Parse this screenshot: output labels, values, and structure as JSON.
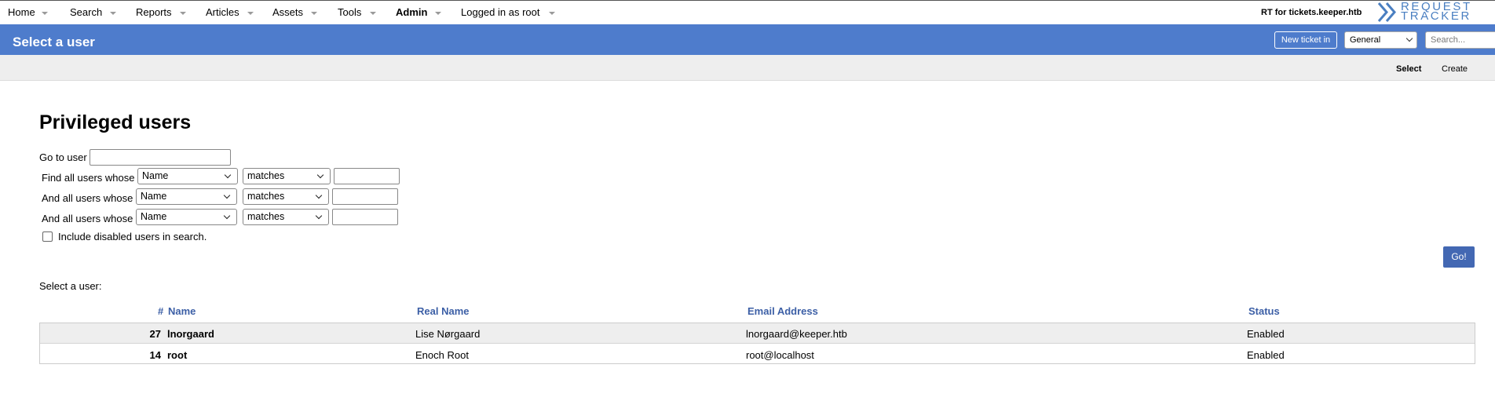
{
  "topnav": {
    "items": [
      {
        "label": "Home"
      },
      {
        "label": "Search"
      },
      {
        "label": "Reports"
      },
      {
        "label": "Articles"
      },
      {
        "label": "Assets"
      },
      {
        "label": "Tools"
      },
      {
        "label": "Admin"
      },
      {
        "label": "Logged in as root"
      }
    ],
    "site_label": "RT for tickets.keeper.htb",
    "logo_line1": "REQUEST",
    "logo_line2": "TRACKER"
  },
  "header": {
    "title": "Select a user",
    "new_ticket_label": "New ticket in",
    "queue_value": "General",
    "search_placeholder": "Search..."
  },
  "subnav": {
    "tabs": [
      {
        "label": "Select",
        "active": true
      },
      {
        "label": "Create",
        "active": false
      }
    ]
  },
  "main": {
    "heading": "Privileged users",
    "goto_label": "Go to user",
    "goto_value": "",
    "criteria": [
      {
        "prefix": "Find all users whose",
        "field": "Name",
        "op": "matches",
        "value": ""
      },
      {
        "prefix": "And all users whose",
        "field": "Name",
        "op": "matches",
        "value": ""
      },
      {
        "prefix": "And all users whose",
        "field": "Name",
        "op": "matches",
        "value": ""
      }
    ],
    "include_disabled_label": "Include disabled users in search.",
    "include_disabled_checked": false,
    "go_label": "Go!",
    "select_label": "Select a user:"
  },
  "table": {
    "columns": [
      "#",
      "Name",
      "Real Name",
      "Email Address",
      "Status"
    ],
    "rows": [
      {
        "id": "27",
        "name": "lnorgaard",
        "real_name": "Lise Nørgaard",
        "email": "lnorgaard@keeper.htb",
        "status": "Enabled"
      },
      {
        "id": "14",
        "name": "root",
        "real_name": "Enoch Root",
        "email": "root@localhost",
        "status": "Enabled"
      }
    ]
  },
  "colors": {
    "header_bg": "#4e7ccc",
    "link_blue": "#3c5fa6",
    "button_blue": "#4368b3",
    "logo_blue": "#4a7fc1"
  }
}
